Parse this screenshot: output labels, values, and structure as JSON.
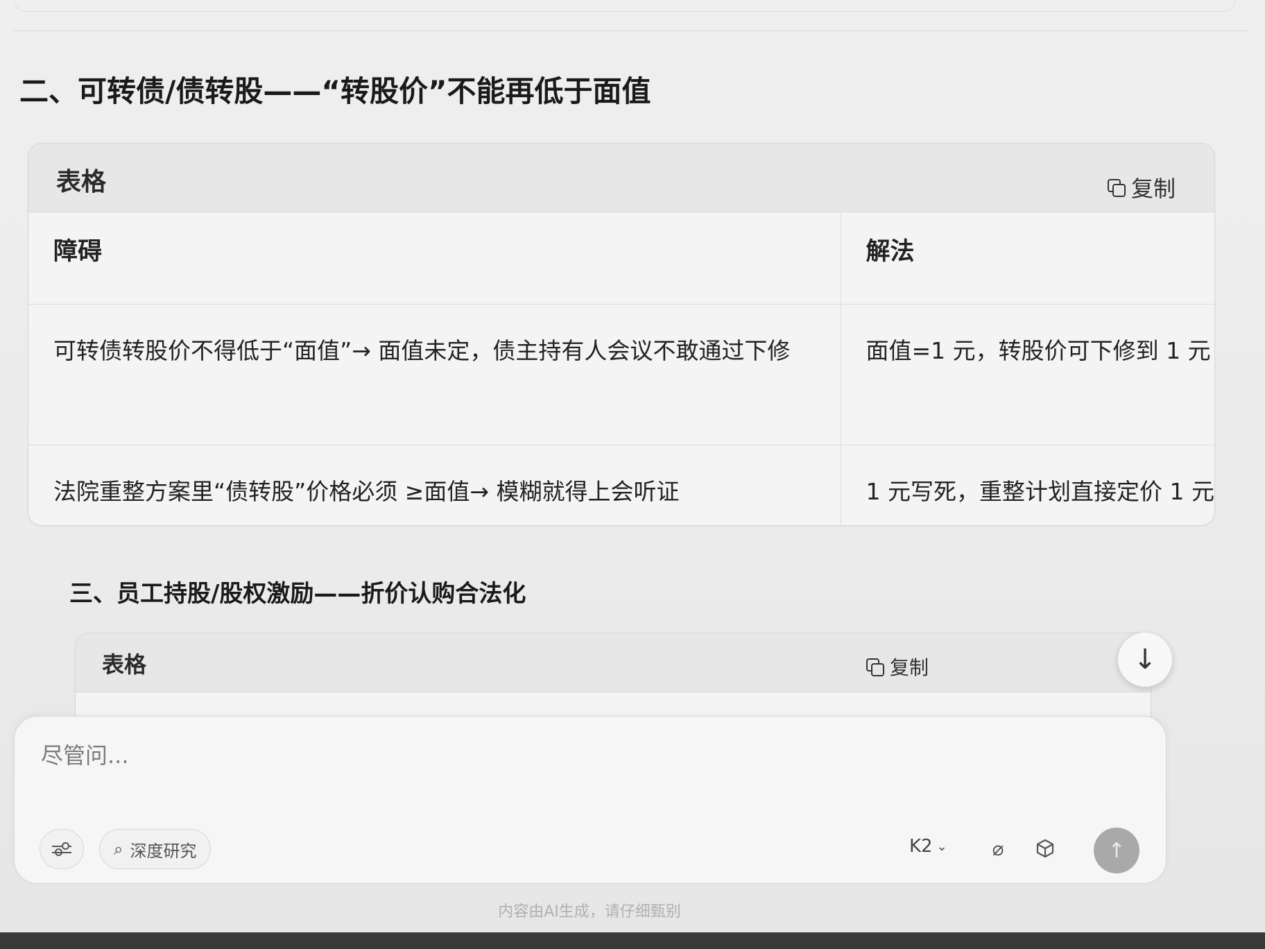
{
  "section2": {
    "title": "二、可转债/债转股——“转股价”不能再低于面值",
    "table": {
      "head_label": "表格",
      "copy_label": "复制",
      "columns": [
        "障碍",
        "解法"
      ],
      "rows": [
        [
          "可转债转股价不得低于“面值”→ 面值未定，债主持有人会议不敢通过下修",
          "面值=1 元，转股价可下修到 1 元"
        ],
        [
          "法院重整方案里“债转股”价格必须 ≥面值→ 模糊就得上会听证",
          "1 元写死，重整计划直接定价 1 元"
        ]
      ]
    }
  },
  "section3": {
    "title": "三、员工持股/股权激励——折价认购合法化",
    "table": {
      "head_label": "表格",
      "copy_label": "复制"
    }
  },
  "scroll_button": {
    "icon": "↓"
  },
  "composer": {
    "placeholder": "尽管问...",
    "deep_research_label": "深度研究",
    "model_label": "K2",
    "send_icon": "↑"
  },
  "disclaimer": "内容由AI生成，请仔细甄别"
}
